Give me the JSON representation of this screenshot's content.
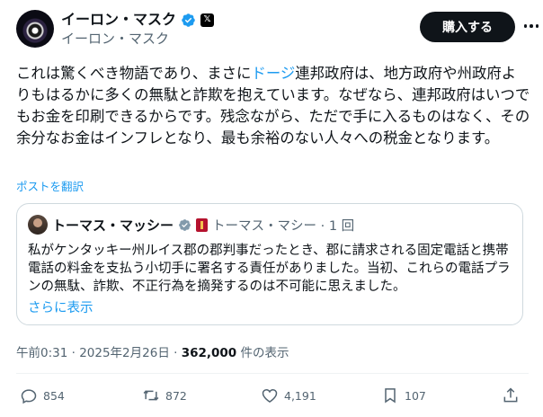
{
  "author": {
    "display_name": "イーロン・マスク",
    "handle": "イーロン・マスク",
    "badge_icon": "verified-badge-icon",
    "affiliation_icon": "x-logo-icon"
  },
  "header": {
    "subscribe_label": "購入する",
    "more_icon": "more-horizontal-icon"
  },
  "tweet": {
    "text_before": "これは驚くべき物語であり、まさに",
    "link_text": "ドージ",
    "text_after": "連邦政府は、地方政府や州政府よりもはるかに多くの無駄と詐欺を抱えています。なぜなら、連邦政府はいつでもお金を印刷できるからです。残念ながら、ただで手に入るものはなく、その余分なお金はインフレとなり、最も余裕のない人々への税金となります。",
    "translate_label": "ポストを翻訳"
  },
  "quote": {
    "name": "トーマス・マッシー",
    "handle_time": "トーマス・マシー · 1 回",
    "body": "私がケンタッキー州ルイス郡の郡判事だったとき、郡に請求される固定電話と携帯電話の料金を支払う小切手に署名する責任がありました。当初、これらの電話プランの無駄、詐欺、不正行為を摘発するのは不可能に思えました。",
    "show_more": "さらに表示"
  },
  "meta": {
    "timestamp": "午前0:31 · 2025年2月26日 · ",
    "views_count": "362,000",
    "views_suffix": " 件の表示"
  },
  "actions": {
    "reply_count": "854",
    "repost_count": "872",
    "like_count": "4,191",
    "bookmark_count": "107"
  },
  "colors": {
    "link": "#1d9bf0",
    "muted": "#536471",
    "verified": "#1d9bf0",
    "text": "#0f1419"
  }
}
